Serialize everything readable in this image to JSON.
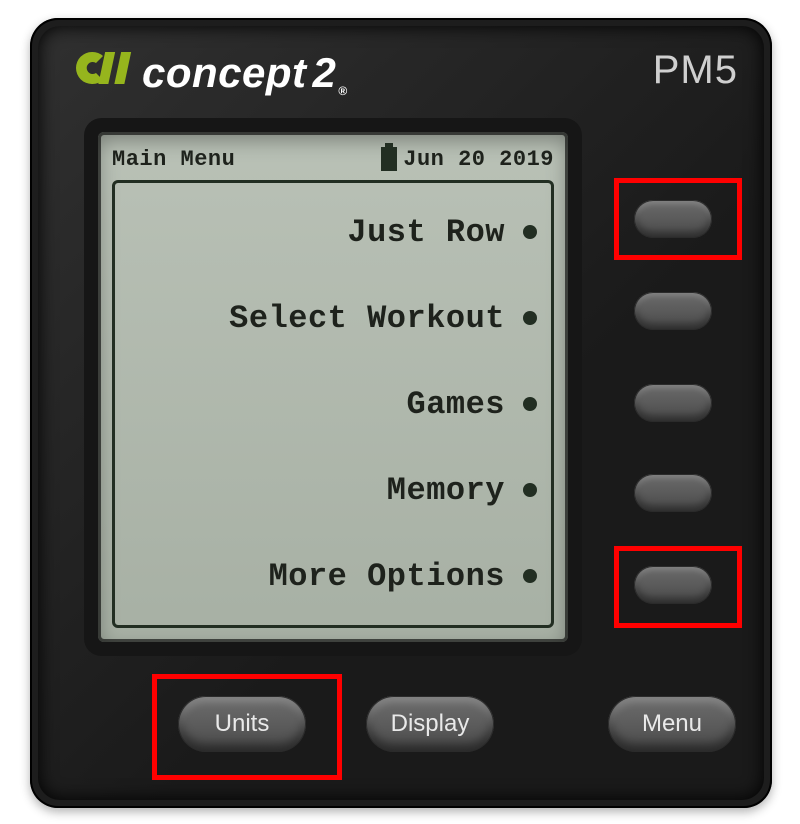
{
  "device": {
    "brand_text": "concept",
    "brand_suffix": "2",
    "model": "PM5"
  },
  "colors": {
    "accent_logo": "#96b51d",
    "highlight": "#ff0000"
  },
  "lcd": {
    "header_title": "Main Menu",
    "date": "Jun  20 2019",
    "menu_items": [
      "Just Row",
      "Select Workout",
      "Games",
      "Memory",
      "More Options"
    ]
  },
  "bottom_buttons": {
    "units": "Units",
    "display": "Display",
    "menu": "Menu"
  },
  "side_button_count": 5,
  "highlights": {
    "side_button_1": true,
    "side_button_5": true,
    "units_button": true
  }
}
